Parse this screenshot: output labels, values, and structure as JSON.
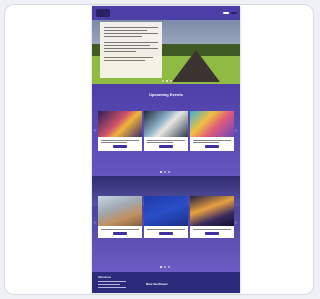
{
  "nav": {
    "links": [
      "",
      "",
      "",
      "",
      ""
    ],
    "buttons": [
      "",
      ""
    ]
  },
  "hero": {
    "panel_title": "",
    "slide_count": 3,
    "active_slide": 2
  },
  "upcoming": {
    "title": "Upcoming Events",
    "cards": [
      {
        "image": "concert-stage",
        "caption": ""
      },
      {
        "image": "dance-crowd",
        "caption": ""
      },
      {
        "image": "colorful-festival",
        "caption": ""
      }
    ]
  },
  "featured": {
    "cards": [
      {
        "image": "outdoor-gathering",
        "caption": ""
      },
      {
        "image": "blue-poster",
        "caption": ""
      },
      {
        "image": "fireworks-crowd",
        "caption": ""
      }
    ]
  },
  "footer": {
    "heading": "About us",
    "logo_text": "Blue Sunflower"
  },
  "colors": {
    "brand": "#4b3ea6",
    "button": "#3d2f9e",
    "footer": "#2c2a7a"
  }
}
